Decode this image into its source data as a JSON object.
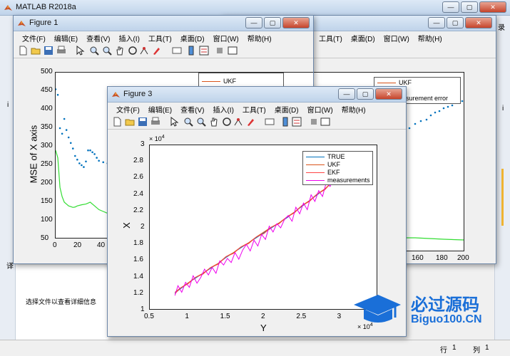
{
  "matlab": {
    "title": "MATLAB R2018a",
    "file_details_hint": "选择文件以查看详细信息",
    "status_row_label": "行",
    "status_row_value": "1",
    "status_col_label": "列",
    "status_col_value": "1",
    "left_letters": [
      "译",
      "i"
    ],
    "right_letters": [
      "录",
      "i"
    ]
  },
  "menus": [
    "文件(F)",
    "编辑(E)",
    "查看(V)",
    "插入(I)",
    "工具(T)",
    "桌面(D)",
    "窗口(W)",
    "帮助(H)"
  ],
  "window_buttons": {
    "min": "—",
    "max": "▢",
    "close": "✕"
  },
  "figure1": {
    "title": "Figure 1",
    "ylabel": "MSE of X axis",
    "yticks": [
      "500",
      "450",
      "400",
      "350",
      "300",
      "250",
      "200",
      "150",
      "100",
      "50"
    ],
    "xticks": [
      "0",
      "20",
      "40"
    ],
    "legend": [
      "UKF"
    ]
  },
  "figure2": {
    "xticks": [
      "160",
      "180",
      "200"
    ],
    "legend": [
      "UKF",
      "F",
      "easurement error"
    ]
  },
  "figure3": {
    "title": "Figure 3",
    "ylabel": "X",
    "xlabel": "Y",
    "exp_y": "× 10",
    "exp_y_pow": "4",
    "exp_x": "× 10",
    "exp_x_pow": "4",
    "yticks": [
      "3",
      "2.8",
      "2.6",
      "2.4",
      "2.2",
      "2",
      "1.8",
      "1.6",
      "1.4",
      "1.2",
      "1"
    ],
    "xticks": [
      "0.5",
      "1",
      "1.5",
      "2",
      "2.5",
      "3"
    ],
    "legend": [
      "TRUE",
      "UKF",
      "EKF",
      "measurements"
    ]
  },
  "watermark": {
    "text": "必过源码",
    "sub": "Biguo100.CN"
  },
  "colors": {
    "ukf": "#d95319",
    "blue_points": "#0072bd",
    "green": "#33dd33",
    "true": "#0072bd",
    "ekf": "#ff4444",
    "measurements": "#ee00ee",
    "watermark": "#1a6fd8"
  },
  "chart_data": [
    {
      "type": "line",
      "chart": "figure1",
      "ylabel": "MSE of X axis",
      "ylim": [
        50,
        500
      ],
      "xlim": [
        0,
        50
      ],
      "series": [
        {
          "values_x": [
            0,
            1,
            2,
            3,
            4,
            5,
            6,
            7,
            8,
            9,
            10,
            11,
            12,
            13,
            14,
            15,
            16,
            17,
            18,
            19,
            20,
            22,
            24,
            26,
            28,
            30,
            32,
            34,
            36,
            38,
            40,
            42,
            44,
            46,
            48
          ],
          "values_y": [
            455,
            440,
            350,
            335,
            375,
            345,
            325,
            310,
            295,
            275,
            265,
            255,
            250,
            245,
            260,
            290,
            290,
            285,
            280,
            270,
            262,
            258,
            255,
            250,
            248,
            246,
            245,
            244,
            243,
            242,
            241,
            240,
            239,
            238,
            238
          ]
        },
        {
          "name": "UKF",
          "values_x": [
            0,
            1,
            2,
            3,
            4,
            5,
            6,
            7,
            8,
            9,
            10,
            12,
            14,
            16,
            18,
            20,
            22,
            24,
            26,
            28,
            30,
            32,
            34,
            36,
            38,
            40,
            42,
            44,
            46,
            48
          ],
          "values_y": [
            290,
            270,
            190,
            165,
            150,
            145,
            140,
            138,
            136,
            137,
            140,
            143,
            145,
            150,
            140,
            130,
            125,
            120,
            118,
            116,
            115,
            114,
            113,
            113,
            114,
            115,
            116,
            116,
            116,
            116
          ]
        }
      ]
    },
    {
      "type": "line",
      "chart": "figure3",
      "xlabel": "Y",
      "ylabel": "X",
      "xlim": [
        0.5,
        3.5
      ],
      "ylim": [
        1,
        3
      ],
      "series": [
        {
          "name": "TRUE",
          "x": [
            0.83,
            0.9,
            1.0,
            1.1,
            1.2,
            1.3,
            1.4,
            1.5,
            1.6,
            1.7,
            1.8,
            1.9,
            2.0,
            2.1,
            2.2,
            2.3,
            2.4,
            2.5,
            2.6,
            2.7,
            2.8,
            2.9,
            3.0,
            3.05
          ],
          "y": [
            1.21,
            1.26,
            1.33,
            1.39,
            1.45,
            1.51,
            1.57,
            1.64,
            1.7,
            1.76,
            1.82,
            1.88,
            1.94,
            2.0,
            2.06,
            2.12,
            2.19,
            2.26,
            2.33,
            2.4,
            2.47,
            2.55,
            2.63,
            2.68
          ]
        },
        {
          "name": "UKF",
          "x": [
            0.83,
            0.9,
            1.0,
            1.1,
            1.2,
            1.3,
            1.4,
            1.5,
            1.6,
            1.7,
            1.8,
            1.9,
            2.0,
            2.1,
            2.2,
            2.3,
            2.4,
            2.5,
            2.6,
            2.7,
            2.8,
            2.9,
            3.0,
            3.05
          ],
          "y": [
            1.22,
            1.27,
            1.33,
            1.4,
            1.45,
            1.52,
            1.57,
            1.65,
            1.7,
            1.77,
            1.82,
            1.89,
            1.95,
            2.01,
            2.06,
            2.13,
            2.19,
            2.27,
            2.33,
            2.41,
            2.47,
            2.56,
            2.63,
            2.68
          ]
        },
        {
          "name": "EKF",
          "x": [
            0.83,
            0.9,
            1.0,
            1.1,
            1.2,
            1.3,
            1.4,
            1.5,
            1.6,
            1.7,
            1.8,
            1.9,
            2.0,
            2.1,
            2.2,
            2.3,
            2.4,
            2.5,
            2.6,
            2.7,
            2.8,
            2.9,
            3.0,
            3.05
          ],
          "y": [
            1.2,
            1.27,
            1.32,
            1.4,
            1.44,
            1.52,
            1.56,
            1.65,
            1.69,
            1.77,
            1.81,
            1.89,
            1.93,
            2.01,
            2.05,
            2.13,
            2.18,
            2.27,
            2.32,
            2.41,
            2.46,
            2.56,
            2.62,
            2.69
          ]
        },
        {
          "name": "measurements",
          "x": [
            0.83,
            0.87,
            0.92,
            0.97,
            1.02,
            1.07,
            1.12,
            1.17,
            1.22,
            1.27,
            1.32,
            1.37,
            1.42,
            1.47,
            1.52,
            1.57,
            1.62,
            1.67,
            1.72,
            1.77,
            1.82,
            1.87,
            1.92,
            1.97,
            2.02,
            2.07,
            2.12,
            2.17,
            2.22,
            2.27,
            2.32,
            2.37,
            2.42,
            2.47,
            2.52,
            2.57,
            2.62,
            2.67,
            2.72,
            2.77,
            2.82,
            2.87,
            2.92,
            2.97,
            3.02,
            3.05
          ],
          "y": [
            1.18,
            1.3,
            1.22,
            1.34,
            1.28,
            1.42,
            1.33,
            1.4,
            1.5,
            1.43,
            1.52,
            1.45,
            1.6,
            1.55,
            1.63,
            1.58,
            1.7,
            1.62,
            1.73,
            1.8,
            1.72,
            1.85,
            1.78,
            1.92,
            1.86,
            2.02,
            1.95,
            2.05,
            2.0,
            2.1,
            2.15,
            2.08,
            2.25,
            2.17,
            2.3,
            2.22,
            2.4,
            2.32,
            2.45,
            2.38,
            2.55,
            2.5,
            2.62,
            2.58,
            2.72,
            2.66
          ]
        }
      ]
    }
  ]
}
